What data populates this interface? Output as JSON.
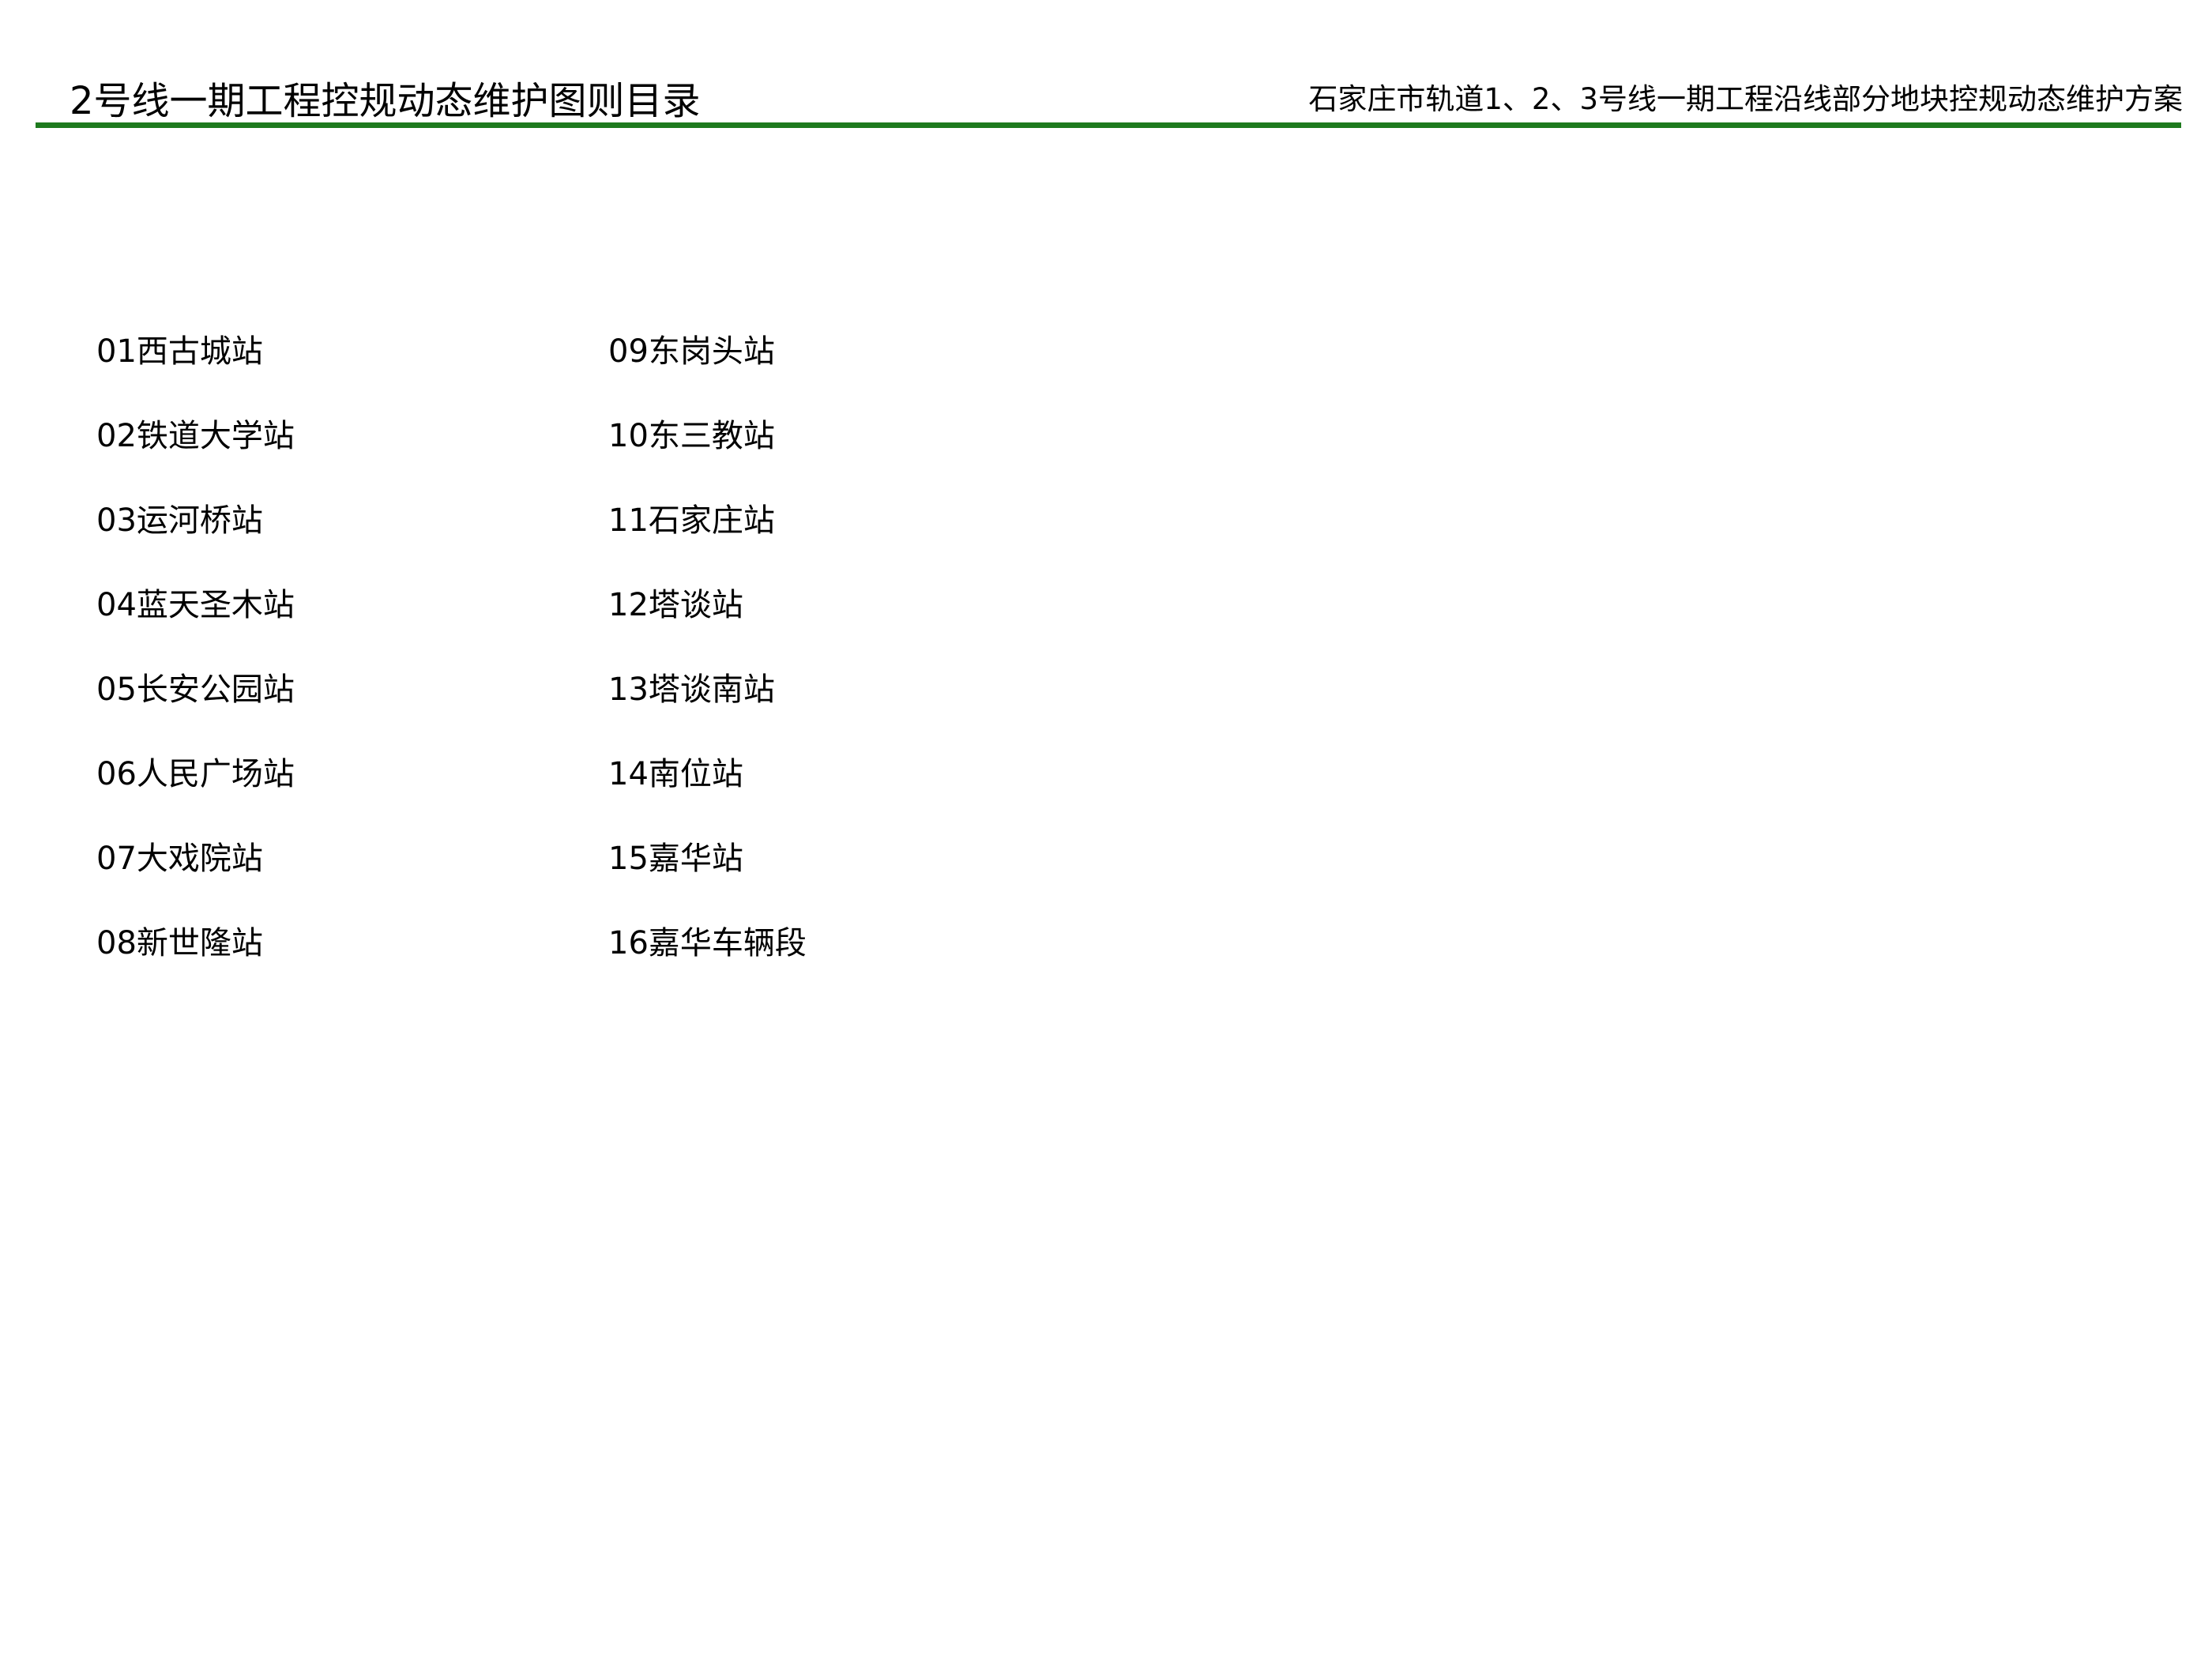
{
  "header": {
    "page_title": "2号线一期工程控规动态维护图则目录",
    "project_title": "石家庄市轨道1、2、3号线一期工程沿线部分地块控规动态维护方案",
    "rule_color": "#1e7a1e"
  },
  "toc": {
    "columns": [
      [
        "01西古城站",
        "02铁道大学站",
        "03运河桥站",
        "04蓝天圣木站",
        "05长安公园站",
        "06人民广场站",
        "07大戏院站",
        "08新世隆站"
      ],
      [
        "09东岗头站",
        "10东三教站",
        "11石家庄站",
        "12塔谈站",
        "13塔谈南站",
        "14南位站",
        "15嘉华站",
        "16嘉华车辆段"
      ]
    ]
  }
}
